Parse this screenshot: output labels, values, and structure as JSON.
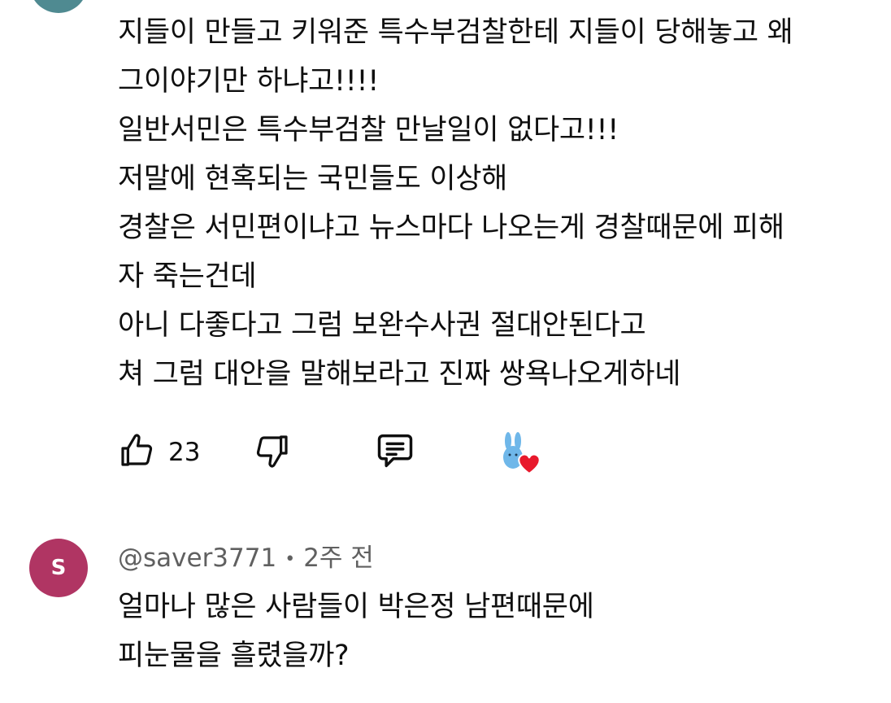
{
  "comment1": {
    "lines": [
      "지들이 만들고 키워준 특수부검찰한테 지들이 당해놓고 왜",
      "그이야기만 하냐고!!!!",
      "일반서민은  특수부검찰 만날일이 없다고!!!",
      "저말에 현혹되는 국민들도 이상해",
      "경찰은 서민편이냐고 뉴스마다 나오는게 경찰때문에 피해",
      "자 죽는건데",
      "아니 다좋다고 그럼 보완수사권 절대안된다고",
      "쳐 그럼 대안을 말해보라고 진짜 쌍욕나오게하네"
    ],
    "like_count": "23",
    "icons": {
      "like": "thumbs-up-icon",
      "dislike": "thumbs-down-icon",
      "reply": "comment-icon",
      "creator_heart": "creator-heart-icon"
    },
    "colors": {
      "avatar": "#4f8a91",
      "heart": "#e8192c",
      "bunny": "#6fb7e9"
    }
  },
  "comment2": {
    "avatar_letter": "S",
    "avatar_color": "#b03563",
    "author": "@saver3771",
    "separator": "•",
    "time": "2주 전",
    "lines": [
      "얼마나 많은 사람들이 박은정 남편때문에",
      "피눈물을 흘렸을까?"
    ]
  }
}
